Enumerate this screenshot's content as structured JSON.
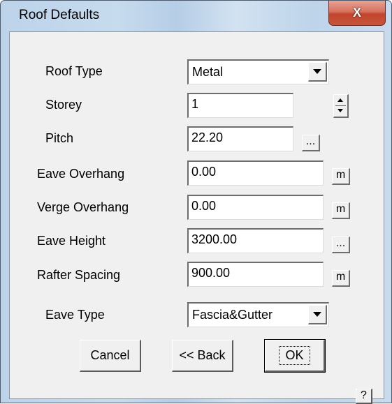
{
  "window": {
    "title": "Roof Defaults",
    "close_label": "X"
  },
  "form": {
    "roof_type": {
      "label": "Roof Type",
      "value": "Metal"
    },
    "storey": {
      "label": "Storey",
      "value": "1"
    },
    "pitch": {
      "label": "Pitch",
      "value": "22.20",
      "button": "..."
    },
    "eave_overhang": {
      "label": "Eave Overhang",
      "value": "0.00",
      "button": "m"
    },
    "verge_overhang": {
      "label": "Verge Overhang",
      "value": "0.00",
      "button": "m"
    },
    "eave_height": {
      "label": "Eave Height",
      "value": "3200.00",
      "button": "..."
    },
    "rafter_spacing": {
      "label": "Rafter Spacing",
      "value": "900.00",
      "button": "m"
    },
    "eave_type": {
      "label": "Eave Type",
      "value": "Fascia&Gutter"
    }
  },
  "buttons": {
    "cancel": "Cancel",
    "back": "<< Back",
    "ok": "OK",
    "help": "?"
  },
  "icons": {
    "close": "close-icon",
    "dropdown": "chevron-down-icon",
    "spinner": "spinner-icon"
  }
}
